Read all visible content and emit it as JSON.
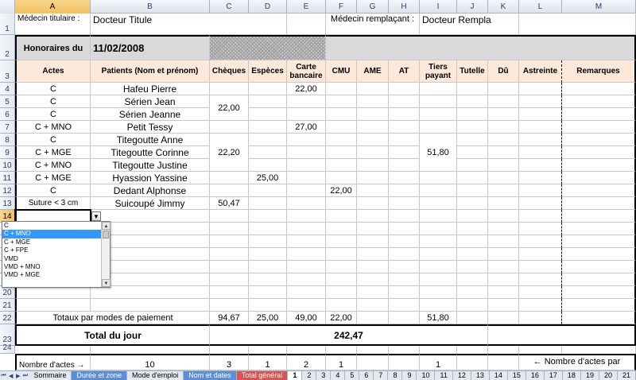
{
  "columns": [
    "A",
    "B",
    "C",
    "D",
    "E",
    "F",
    "G",
    "H",
    "I",
    "J",
    "K",
    "L",
    "M"
  ],
  "rows": [
    "1",
    "2",
    "3",
    "4",
    "5",
    "6",
    "7",
    "8",
    "9",
    "10",
    "11",
    "12",
    "13",
    "14",
    "15",
    "16",
    "17",
    "18",
    "19",
    "20",
    "21",
    "22",
    "23",
    "24"
  ],
  "row1": {
    "medecin_titulaire_label": "Médecin titulaire :",
    "medecin_titulaire_value": "Docteur Titule",
    "remplacant_label": "Médecin remplaçant :",
    "remplacant_value": "Docteur Rempla"
  },
  "row2": {
    "honoraires_label": "Honoraires du",
    "date": "11/02/2008"
  },
  "headers": [
    "Actes",
    "Patients (Nom et prénom)",
    "Chèques",
    "Espèces",
    "Carte bancaire",
    "CMU",
    "AME",
    "AT",
    "Tiers payant",
    "Tutelle",
    "Dû",
    "Astreinte",
    "Remarques"
  ],
  "entries": [
    {
      "acte": "C",
      "patient": "Hafeu Pierre",
      "carte": "22,00"
    },
    {
      "acte": "C",
      "patient": "Sérien Jean"
    },
    {
      "acte": "C",
      "patient": "Sérien Jeanne"
    },
    {
      "acte": "C + MNO",
      "patient": "Petit Tessy",
      "carte": "27,00"
    },
    {
      "acte": "C",
      "patient": "Titegoutte Anne"
    },
    {
      "acte": "C + MGE",
      "patient": "Titegoutte Corinne"
    },
    {
      "acte": "C + MNO",
      "patient": "Titegoutte Justine"
    },
    {
      "acte": "C + MGE",
      "patient": "Hyassion Yassine",
      "especes": "25,00"
    },
    {
      "acte": "C",
      "patient": "Dedant Alphonse",
      "cmu": "22,00"
    },
    {
      "acte": "Suture < 3 cm",
      "patient": "Suicoupé Jimmy",
      "cheque": "50,47"
    }
  ],
  "merged_values": {
    "cheque_rows_5_6": "22,00",
    "cheque_rows_8_10": "22,20",
    "tiers_rows_8_10": "51,80"
  },
  "dropdown_options": [
    "C",
    "C + MNO",
    "C + MGE",
    "C + FPE",
    "VMD",
    "VMD + MNO",
    "VMD + MGE"
  ],
  "dropdown_selected_index": 1,
  "totals": {
    "label": "Totaux par modes de paiement",
    "cheques": "94,67",
    "especes": "25,00",
    "carte": "49,00",
    "cmu": "22,00",
    "tiers": "51,80"
  },
  "total_jour": {
    "label": "Total du jour",
    "value": "242,47"
  },
  "nombre_actes": {
    "label": "Nombre d'actes →",
    "total": "10",
    "cheques": "3",
    "especes": "1",
    "carte": "2",
    "cmu": "1",
    "tiers": "1",
    "note": "← Nombre d'actes par"
  },
  "tabs": [
    {
      "label": "Sommaire",
      "style": ""
    },
    {
      "label": "Durée et zone",
      "style": "blue"
    },
    {
      "label": "Mode d'emploi",
      "style": ""
    },
    {
      "label": "Nom et dates",
      "style": "blue"
    },
    {
      "label": "Total général",
      "style": "red"
    },
    {
      "label": "1",
      "style": "active"
    },
    {
      "label": "2",
      "style": ""
    },
    {
      "label": "3",
      "style": ""
    },
    {
      "label": "4",
      "style": ""
    },
    {
      "label": "5",
      "style": ""
    },
    {
      "label": "6",
      "style": ""
    },
    {
      "label": "7",
      "style": ""
    },
    {
      "label": "8",
      "style": ""
    },
    {
      "label": "9",
      "style": ""
    },
    {
      "label": "10",
      "style": ""
    },
    {
      "label": "11",
      "style": ""
    },
    {
      "label": "12",
      "style": ""
    },
    {
      "label": "13",
      "style": ""
    },
    {
      "label": "14",
      "style": ""
    },
    {
      "label": "15",
      "style": ""
    },
    {
      "label": "16",
      "style": ""
    },
    {
      "label": "17",
      "style": ""
    },
    {
      "label": "18",
      "style": ""
    },
    {
      "label": "19",
      "style": ""
    },
    {
      "label": "20",
      "style": ""
    },
    {
      "label": "21",
      "style": ""
    }
  ],
  "tab_nav": [
    "⏮",
    "◀",
    "▶",
    "⏭"
  ]
}
